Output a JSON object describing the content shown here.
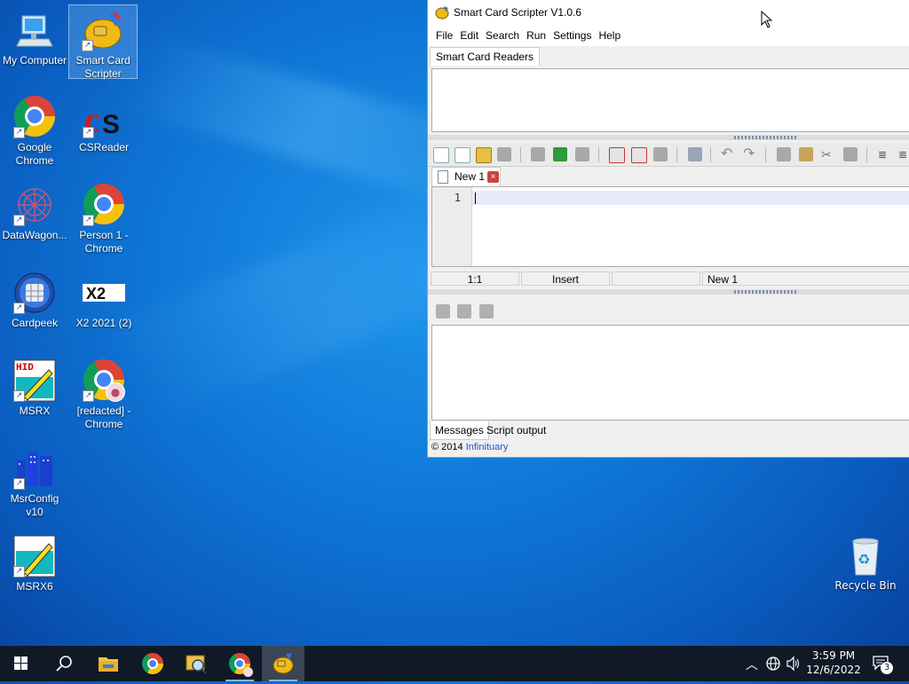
{
  "desktop": {
    "icons": [
      {
        "label": "My Computer"
      },
      {
        "label": "Smart Card Scripter"
      },
      {
        "label": "Google Chrome"
      },
      {
        "label": "CSReader"
      },
      {
        "label": "DataWagon..."
      },
      {
        "label": "Person 1 - Chrome"
      },
      {
        "label": "Cardpeek"
      },
      {
        "label": "X2 2021 (2)"
      },
      {
        "label": "MSRX"
      },
      {
        "label": "[redacted] - Chrome"
      },
      {
        "label": "MsrConfig v10"
      },
      {
        "label": "MSRX6"
      }
    ],
    "recycle_bin": "Recycle Bin"
  },
  "app": {
    "title": "Smart Card Scripter V1.0.6",
    "menu": [
      "File",
      "Edit",
      "Search",
      "Run",
      "Settings",
      "Help"
    ],
    "readers_tab": "Smart Card Readers",
    "editor_tab": "New 1",
    "editor_tab_close": "×",
    "line_numbers": [
      "1"
    ],
    "status": {
      "position": "1:1",
      "mode": "Insert",
      "blank": "",
      "document": "New 1"
    },
    "bottom_tabs": [
      "Messages",
      "Script output"
    ],
    "footer": {
      "copyright": "© 2014",
      "link": "Infinituary"
    }
  },
  "taskbar": {
    "time": "3:59 PM",
    "date": "12/6/2022",
    "notification_count": "3"
  },
  "icons": [
    "windows-start-icon",
    "search-icon",
    "file-explorer-icon",
    "chrome-icon",
    "magnifier-icon",
    "chrome-profile-icon",
    "smart-card-scripter-icon",
    "chevron-up-icon",
    "network-icon",
    "volume-icon",
    "notification-icon"
  ],
  "colors": {
    "accent": "#0f78d7",
    "taskbar": "#101926",
    "link": "#1c55c6"
  }
}
